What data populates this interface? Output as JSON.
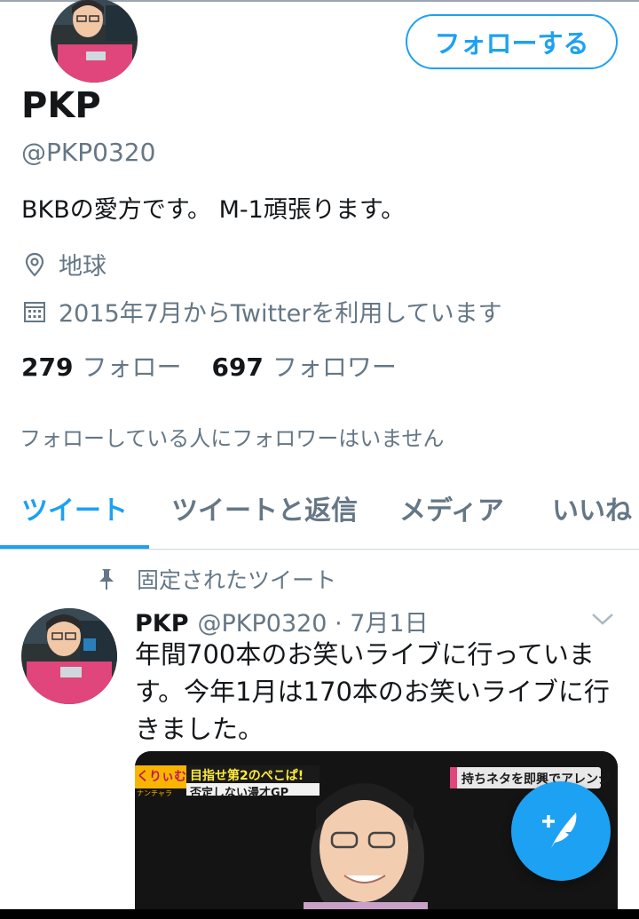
{
  "profile": {
    "name": "PKP",
    "handle": "@PKP0320",
    "bio": "BKBの愛方です。 M-1頑張ります。",
    "location": "地球",
    "joined": "2015年7月からTwitterを利用しています",
    "following_count": "279",
    "following_label": "フォロー",
    "followers_count": "697",
    "followers_label": "フォロワー",
    "no_mutual_followers": "フォローしている人にフォロワーはいません"
  },
  "follow_button": {
    "label": "フォローする"
  },
  "tabs": [
    {
      "label": "ツイート",
      "active": true
    },
    {
      "label": "ツイートと返信",
      "active": false
    },
    {
      "label": "メディア",
      "active": false
    },
    {
      "label": "いいね",
      "active": false
    }
  ],
  "pinned_tweet": {
    "pinned_label": "固定されたツイート",
    "author_name": "PKP",
    "author_handle_date": "@PKP0320 · 7月1日",
    "text": "年間700本のお笑いライブに行っています。今年1月は170本のお笑いライブに行きました。",
    "media": {
      "caption_top": "目指せ第2のぺこぱ!",
      "caption_left": "くりぃむ",
      "caption_sub": "ナンチャラ",
      "caption_main": "否定しない漫才GP",
      "caption_right": "持ちネタを即興でアレンジ"
    }
  },
  "icons": {
    "location": "location-pin-icon",
    "calendar": "calendar-icon",
    "pin": "pin-icon",
    "chevron": "chevron-down-icon",
    "compose": "compose-tweet-icon"
  },
  "colors": {
    "accent": "#1da1f2",
    "text_primary": "#14171a",
    "text_secondary": "#657786"
  }
}
